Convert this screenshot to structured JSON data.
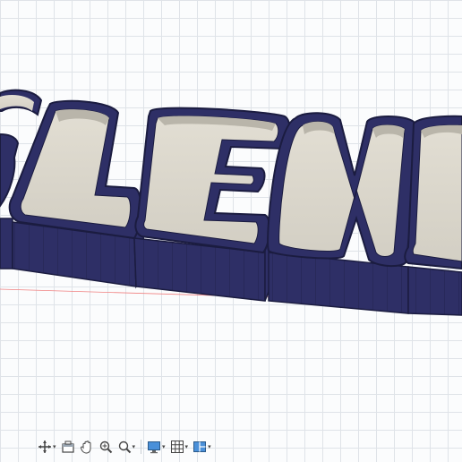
{
  "app": {
    "type": "cad-3d-viewport"
  },
  "model": {
    "text_visible": "SLENA",
    "body_color": "#2e2f66",
    "floor_color": "#d9d6cc",
    "wall_inner_color": "#cfcbc0"
  },
  "viewport": {
    "grid_color": "#dfe3e8",
    "axis_color": "#f08080"
  },
  "toolbar": {
    "items": [
      {
        "name": "orbit-icon",
        "has_menu": true
      },
      {
        "name": "look-at-icon",
        "has_menu": false
      },
      {
        "name": "pan-icon",
        "has_menu": false
      },
      {
        "name": "zoom-icon",
        "has_menu": false
      },
      {
        "name": "fit-icon",
        "has_menu": true
      },
      {
        "name": "display-settings-icon",
        "has_menu": true
      },
      {
        "name": "grid-snaps-icon",
        "has_menu": true
      },
      {
        "name": "viewports-icon",
        "has_menu": true
      }
    ]
  }
}
